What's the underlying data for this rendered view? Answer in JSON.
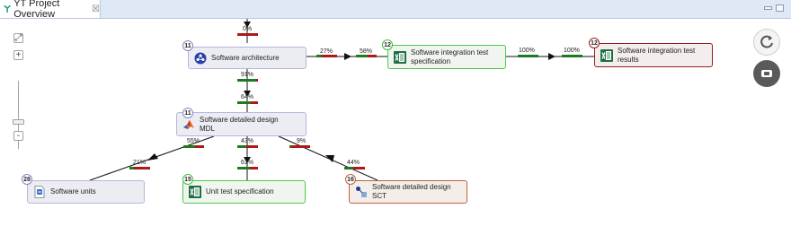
{
  "tab": {
    "title": "YT Project Overview",
    "close_glyph": "☒"
  },
  "zoom_controls": {
    "fit_glyph": "⤢",
    "plus": "+",
    "minus": "-"
  },
  "nodes": {
    "architecture": {
      "count": "11",
      "label_1": "Software architecture",
      "label_2": ""
    },
    "integration_spec": {
      "count": "12",
      "label_1": "Software integration test",
      "label_2": "specification"
    },
    "integration_results": {
      "count": "12",
      "label_1": "Software integration test",
      "label_2": "results"
    },
    "detailed_mdl": {
      "count": "11",
      "label_1": "Software detailed design",
      "label_2": "MDL"
    },
    "units": {
      "count": "28",
      "label_1": "Software units"
    },
    "unit_test_spec": {
      "count": "15",
      "label_1": "Unit test specification"
    },
    "detailed_sct": {
      "count": "16",
      "label_1": "Software detailed design SCT"
    }
  },
  "percentages": {
    "top_in": "0%",
    "arch_to_spec_a": "27%",
    "arch_to_spec_b": "58%",
    "spec_to_results_a": "100%",
    "spec_to_results_b": "100%",
    "arch_down": "91%",
    "mdl_in": "64%",
    "mdl_left": "55%",
    "mdl_down": "43%",
    "mdl_right": "9%",
    "units_in": "21%",
    "unit_test_in": "61%",
    "sct_in": "44%"
  },
  "colors": {
    "bar_green": "#1f7a1f",
    "bar_red": "#b01818",
    "node_border_blue": "#a9a8d8",
    "node_border_green": "#4cc94c",
    "node_border_darkred": "#9b1b1b",
    "node_border_orange": "#c2603a"
  },
  "icons": {
    "tab": "project-tree-icon",
    "architecture": "architecture-icon",
    "excel": "excel-icon",
    "matlab": "matlab-icon",
    "unit": "document-icon",
    "sct": "statechart-icon",
    "refresh": "refresh-icon",
    "toggle": "toggle-icon"
  }
}
